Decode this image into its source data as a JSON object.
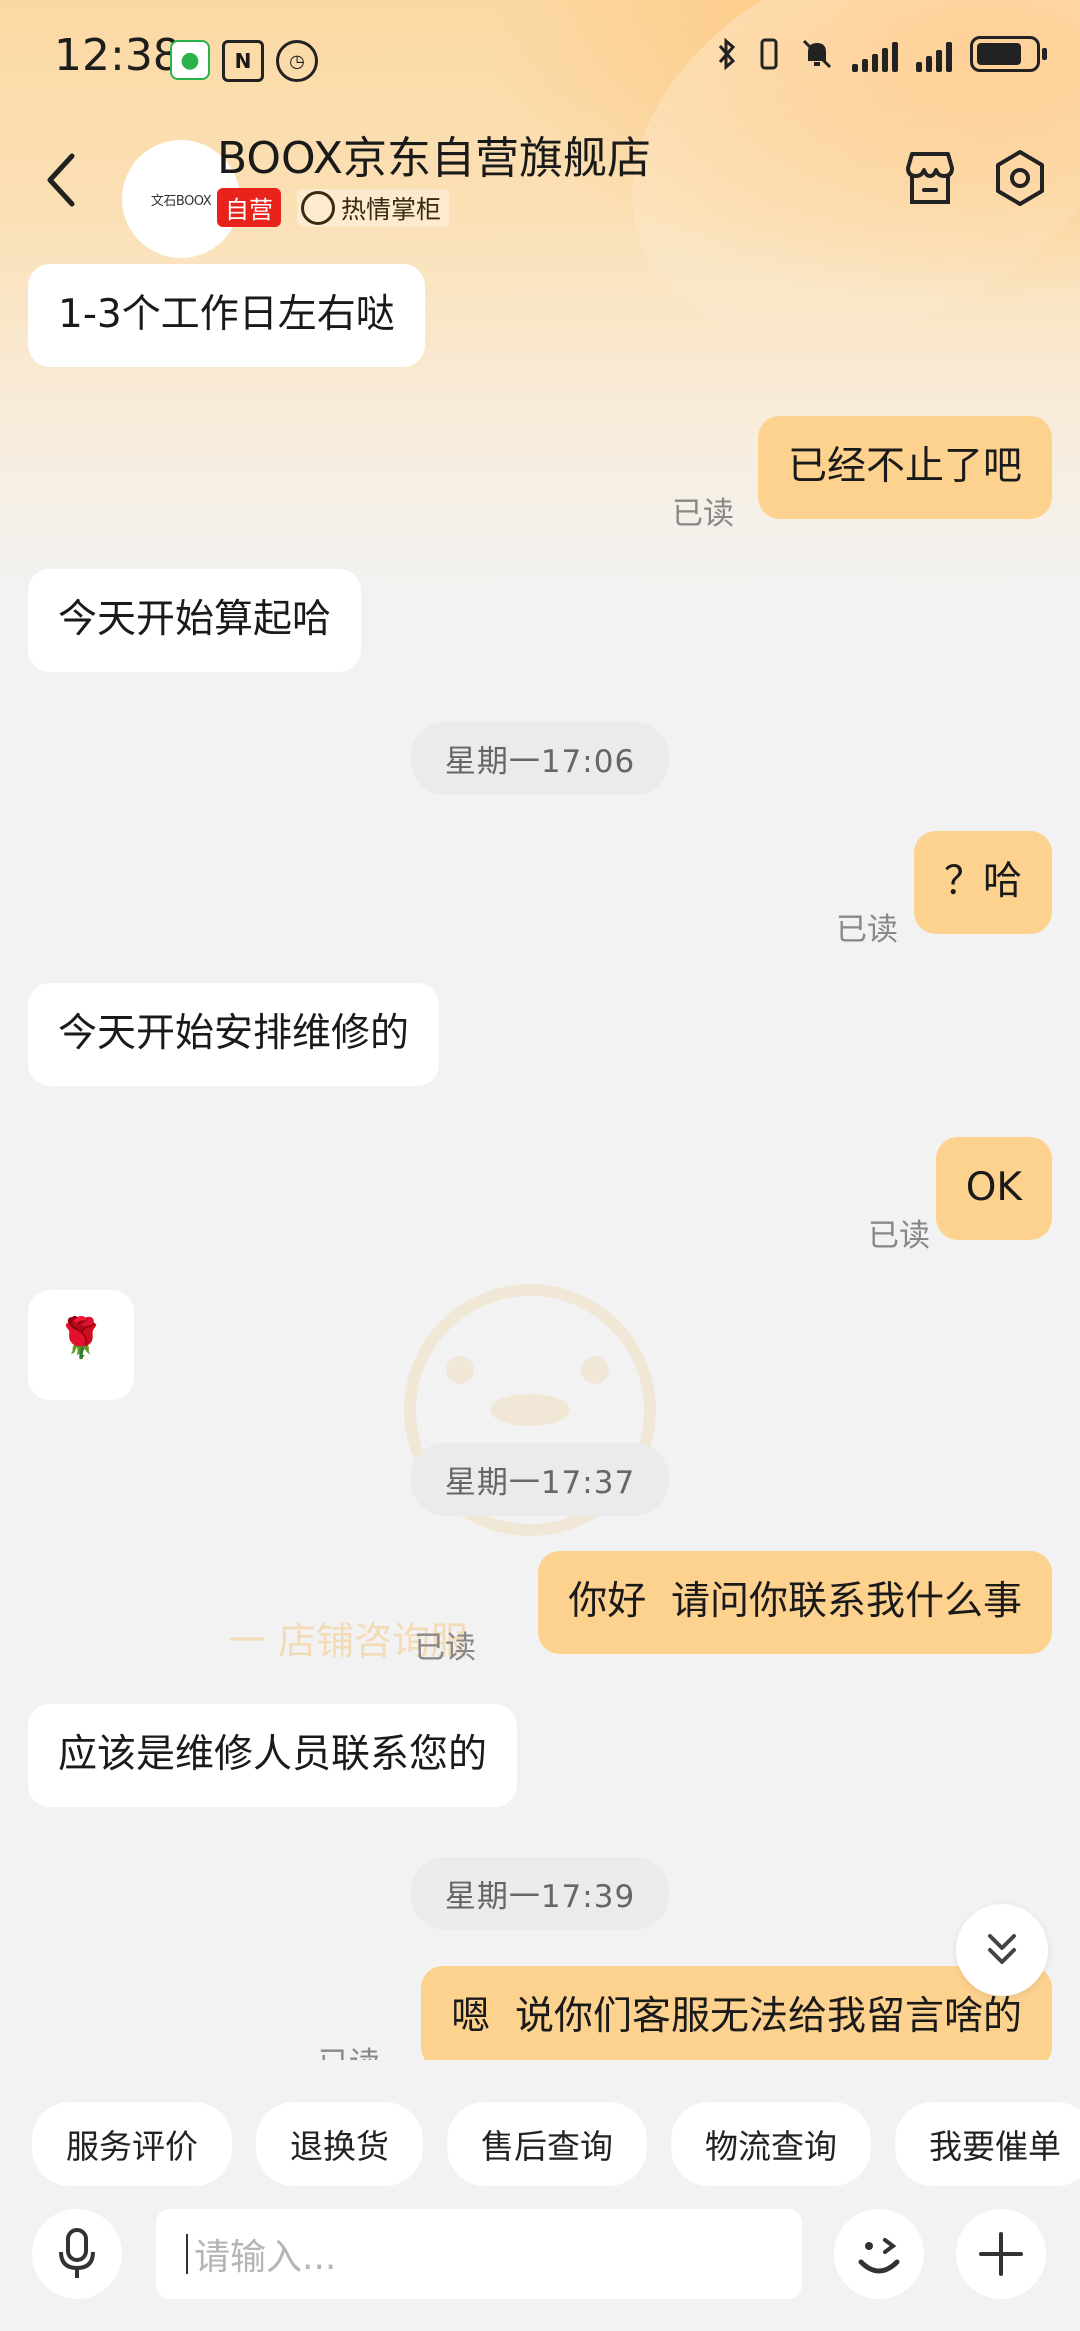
{
  "status_bar": {
    "time": "12:38",
    "icons": [
      "wechat-icon",
      "nfc-icon",
      "alarm-icon",
      "bluetooth-icon",
      "vibrate-icon",
      "mute-icon",
      "signal-icon",
      "signal-icon",
      "battery-icon"
    ]
  },
  "header": {
    "avatar_text": "文石BOOX",
    "shop_name": "BOOX京东自营旗舰店",
    "tag_self": "自营",
    "tag_warm": "热情掌柜"
  },
  "messages": [
    {
      "side": "left",
      "text": "1-3个工作日左右哒"
    },
    {
      "side": "right",
      "text": "已经不止了吧",
      "status": "已读"
    },
    {
      "side": "left",
      "text": "今天开始算起哈"
    },
    {
      "side": "time",
      "text": "星期一17:06"
    },
    {
      "side": "right",
      "text": "？哈",
      "status": "已读"
    },
    {
      "side": "left",
      "text": "今天开始安排维修的"
    },
    {
      "side": "right",
      "text": "OK",
      "status": "已读"
    },
    {
      "side": "left",
      "text": "🌹"
    },
    {
      "side": "time",
      "text": "星期一17:37"
    },
    {
      "side": "right",
      "text": "你好  请问你联系我什么事",
      "status": "已读"
    },
    {
      "side": "left",
      "text": "应该是维修人员联系您的"
    },
    {
      "side": "time",
      "text": "星期一17:39"
    },
    {
      "side": "right",
      "text": "嗯  说你们客服无法给我留言啥的",
      "status": "已读"
    }
  ],
  "watermark_text": "一  店铺咨询服",
  "quick_actions": [
    "服务评价",
    "退换货",
    "售后查询",
    "物流查询",
    "我要催单"
  ],
  "input": {
    "placeholder": "请输入..."
  },
  "colors": {
    "my_bubble": "#fdd18e",
    "their_bubble": "#ffffff",
    "self_tag": "#e8231c",
    "background": "#f2f2f2"
  }
}
